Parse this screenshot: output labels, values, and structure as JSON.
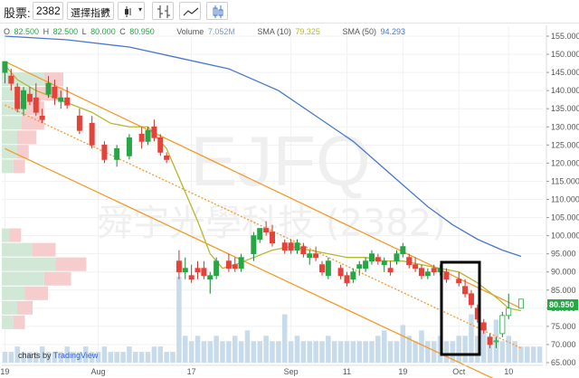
{
  "toolbar": {
    "symbol_label": "股票:",
    "symbol_value": "2382",
    "interval_select": "選擇指數",
    "buttons": [
      "chart-type-icon",
      "compare-icon",
      "line-style-icon",
      "candles-icon"
    ]
  },
  "legend": {
    "o_label": "O",
    "o_value": "82.500",
    "h_label": "H",
    "h_value": "82.500",
    "l_label": "L",
    "l_value": "80.000",
    "c_label": "C",
    "c_value": "80.950",
    "volume_label": "Volume",
    "volume_value": "7.052M",
    "sma10_label": "SMA (10)",
    "sma10_value": "79.325",
    "sma50_label": "SMA (50)",
    "sma50_value": "94.293"
  },
  "watermark": {
    "line1": "EJFQ",
    "line2": "舜宇光學科技 (2382)"
  },
  "attribution": {
    "prefix": "charts by",
    "brand": "TradingView"
  },
  "price_tag": "80.950",
  "colors": {
    "up": "#26a645",
    "down": "#e5433a",
    "sma10": "#b7b733",
    "sma50": "#4a78c8",
    "channel": "#f39a2b",
    "volume": "#c7dbea",
    "vprofile_up": "#cce6d3",
    "vprofile_down": "#f5c6c6",
    "price_tag_bg": "#26a645",
    "highlight_box": "#000000"
  },
  "chart_data": {
    "type": "candlestick",
    "ylim": [
      65,
      155
    ],
    "y_ticks": [
      "155.000",
      "150.000",
      "145.000",
      "140.000",
      "135.000",
      "130.000",
      "125.000",
      "120.000",
      "115.000",
      "110.000",
      "105.000",
      "100.000",
      "95.000",
      "90.000",
      "85.000",
      "80.000",
      "75.000",
      "70.000",
      "65.000"
    ],
    "x_ticks": [
      "19",
      "Aug",
      "17",
      "Sep",
      "11",
      "19",
      "Oct",
      "10"
    ],
    "x_tick_index": [
      0,
      15,
      30,
      46,
      55,
      64,
      73,
      81
    ],
    "n_bars": 87,
    "candles": [
      {
        "i": 0,
        "o": 145,
        "h": 147,
        "l": 142,
        "c": 148
      },
      {
        "i": 1,
        "o": 144,
        "h": 146,
        "l": 140,
        "c": 142
      },
      {
        "i": 2,
        "o": 141,
        "h": 142,
        "l": 134,
        "c": 135
      },
      {
        "i": 3,
        "o": 135,
        "h": 141,
        "l": 133,
        "c": 140
      },
      {
        "i": 4,
        "o": 139,
        "h": 141,
        "l": 136,
        "c": 137
      },
      {
        "i": 5,
        "o": 138,
        "h": 142,
        "l": 133,
        "c": 134
      },
      {
        "i": 6,
        "o": 133,
        "h": 135,
        "l": 131,
        "c": 132
      },
      {
        "i": 7,
        "o": 139,
        "h": 144,
        "l": 138,
        "c": 142
      },
      {
        "i": 8,
        "o": 141,
        "h": 143,
        "l": 136,
        "c": 138
      },
      {
        "i": 9,
        "o": 137,
        "h": 140,
        "l": 135,
        "c": 138
      },
      {
        "i": 10,
        "o": 138,
        "h": 141,
        "l": 135,
        "c": 136
      },
      {
        "i": 12,
        "o": 133,
        "h": 135,
        "l": 128,
        "c": 129
      },
      {
        "i": 14,
        "o": 131,
        "h": 133,
        "l": 124,
        "c": 125
      },
      {
        "i": 16,
        "o": 125,
        "h": 126,
        "l": 120,
        "c": 121
      },
      {
        "i": 18,
        "o": 121,
        "h": 125,
        "l": 119,
        "c": 124
      },
      {
        "i": 20,
        "o": 122,
        "h": 128,
        "l": 121,
        "c": 127
      },
      {
        "i": 22,
        "o": 128,
        "h": 130,
        "l": 124,
        "c": 126
      },
      {
        "i": 23,
        "o": 126,
        "h": 130,
        "l": 125,
        "c": 129
      },
      {
        "i": 24,
        "o": 130,
        "h": 132,
        "l": 126,
        "c": 127
      },
      {
        "i": 25,
        "o": 127,
        "h": 128,
        "l": 122,
        "c": 123
      },
      {
        "i": 26,
        "o": 122,
        "h": 123,
        "l": 120,
        "c": 121
      },
      {
        "i": 28,
        "o": 93,
        "h": 96,
        "l": 88,
        "c": 90
      },
      {
        "i": 29,
        "o": 90,
        "h": 94,
        "l": 88,
        "c": 91
      },
      {
        "i": 30,
        "o": 89,
        "h": 92,
        "l": 87,
        "c": 88
      },
      {
        "i": 31,
        "o": 91,
        "h": 93,
        "l": 88,
        "c": 90
      },
      {
        "i": 32,
        "o": 91,
        "h": 93,
        "l": 88,
        "c": 89
      },
      {
        "i": 33,
        "o": 88,
        "h": 90,
        "l": 84,
        "c": 89
      },
      {
        "i": 34,
        "o": 89,
        "h": 94,
        "l": 88,
        "c": 93
      },
      {
        "i": 36,
        "o": 93,
        "h": 95,
        "l": 90,
        "c": 91
      },
      {
        "i": 37,
        "o": 92,
        "h": 94,
        "l": 90,
        "c": 91
      },
      {
        "i": 38,
        "o": 91,
        "h": 95,
        "l": 90,
        "c": 94
      },
      {
        "i": 40,
        "o": 95,
        "h": 101,
        "l": 93,
        "c": 100
      },
      {
        "i": 41,
        "o": 99,
        "h": 102,
        "l": 98,
        "c": 102
      },
      {
        "i": 42,
        "o": 102,
        "h": 104,
        "l": 100,
        "c": 101
      },
      {
        "i": 43,
        "o": 101,
        "h": 103,
        "l": 97,
        "c": 98
      },
      {
        "i": 45,
        "o": 98,
        "h": 99,
        "l": 95,
        "c": 96
      },
      {
        "i": 46,
        "o": 98,
        "h": 99,
        "l": 95,
        "c": 96
      },
      {
        "i": 47,
        "o": 96,
        "h": 99,
        "l": 95,
        "c": 98
      },
      {
        "i": 48,
        "o": 97,
        "h": 98,
        "l": 94,
        "c": 95
      },
      {
        "i": 49,
        "o": 94,
        "h": 96,
        "l": 92,
        "c": 95
      },
      {
        "i": 50,
        "o": 95,
        "h": 97,
        "l": 93,
        "c": 94
      },
      {
        "i": 51,
        "o": 92,
        "h": 93,
        "l": 89,
        "c": 90
      },
      {
        "i": 52,
        "o": 89,
        "h": 94,
        "l": 88,
        "c": 93
      },
      {
        "i": 54,
        "o": 91,
        "h": 92,
        "l": 88,
        "c": 89
      },
      {
        "i": 55,
        "o": 89,
        "h": 90,
        "l": 86,
        "c": 87
      },
      {
        "i": 56,
        "o": 88,
        "h": 91,
        "l": 87,
        "c": 90
      },
      {
        "i": 57,
        "o": 91,
        "h": 93,
        "l": 89,
        "c": 92
      },
      {
        "i": 58,
        "o": 91,
        "h": 94,
        "l": 90,
        "c": 93
      },
      {
        "i": 59,
        "o": 93,
        "h": 96,
        "l": 92,
        "c": 95
      },
      {
        "i": 60,
        "o": 94,
        "h": 95,
        "l": 92,
        "c": 93
      },
      {
        "i": 61,
        "o": 92,
        "h": 94,
        "l": 90,
        "c": 93
      },
      {
        "i": 62,
        "o": 91,
        "h": 93,
        "l": 89,
        "c": 90
      },
      {
        "i": 63,
        "o": 93,
        "h": 96,
        "l": 92,
        "c": 95
      },
      {
        "i": 64,
        "o": 95,
        "h": 98,
        "l": 94,
        "c": 97
      },
      {
        "i": 65,
        "o": 94,
        "h": 95,
        "l": 91,
        "c": 92
      },
      {
        "i": 66,
        "o": 92,
        "h": 94,
        "l": 90,
        "c": 91
      },
      {
        "i": 67,
        "o": 91,
        "h": 92,
        "l": 88,
        "c": 89
      },
      {
        "i": 68,
        "o": 89,
        "h": 91,
        "l": 88,
        "c": 90
      },
      {
        "i": 69,
        "o": 91,
        "h": 92,
        "l": 89,
        "c": 90
      },
      {
        "i": 70,
        "o": 90,
        "h": 92,
        "l": 89,
        "c": 91
      },
      {
        "i": 71,
        "o": 90,
        "h": 91,
        "l": 87,
        "c": 88
      },
      {
        "i": 73,
        "o": 88,
        "h": 90,
        "l": 86,
        "c": 87
      },
      {
        "i": 74,
        "o": 86,
        "h": 88,
        "l": 83,
        "c": 84
      },
      {
        "i": 75,
        "o": 84,
        "h": 85,
        "l": 80,
        "c": 81
      },
      {
        "i": 76,
        "o": 80,
        "h": 81,
        "l": 76,
        "c": 77
      },
      {
        "i": 77,
        "o": 76,
        "h": 77,
        "l": 73,
        "c": 74
      },
      {
        "i": 78,
        "o": 72,
        "h": 73,
        "l": 69,
        "c": 70
      },
      {
        "i": 79,
        "o": 71,
        "h": 72,
        "l": 69,
        "c": 71
      },
      {
        "i": 80,
        "o": 73,
        "h": 79,
        "l": 72,
        "c": 78
      },
      {
        "i": 81,
        "o": 78,
        "h": 84,
        "l": 77,
        "c": 80
      },
      {
        "i": 83,
        "o": 80.0,
        "h": 82.5,
        "l": 80.0,
        "c": 82.5
      }
    ],
    "sma10": [
      [
        0,
        147
      ],
      [
        2,
        143
      ],
      [
        5,
        140
      ],
      [
        8,
        138
      ],
      [
        11,
        136
      ],
      [
        14,
        134
      ],
      [
        17,
        131
      ],
      [
        20,
        130
      ],
      [
        23,
        130
      ],
      [
        26,
        124
      ],
      [
        28,
        116
      ],
      [
        31,
        104
      ],
      [
        33,
        95
      ],
      [
        35,
        91
      ],
      [
        37,
        92
      ],
      [
        40,
        94
      ],
      [
        43,
        96
      ],
      [
        46,
        97
      ],
      [
        49,
        96
      ],
      [
        52,
        95
      ],
      [
        55,
        94
      ],
      [
        58,
        94
      ],
      [
        61,
        93
      ],
      [
        64,
        93
      ],
      [
        67,
        92
      ],
      [
        70,
        91
      ],
      [
        73,
        90
      ],
      [
        76,
        87
      ],
      [
        79,
        83
      ],
      [
        81,
        80
      ],
      [
        83,
        79.3
      ]
    ],
    "sma50": [
      [
        0,
        155
      ],
      [
        10,
        154
      ],
      [
        20,
        152
      ],
      [
        28,
        149
      ],
      [
        36,
        146
      ],
      [
        44,
        140
      ],
      [
        50,
        133
      ],
      [
        56,
        126
      ],
      [
        60,
        120
      ],
      [
        64,
        114
      ],
      [
        68,
        108
      ],
      [
        72,
        103
      ],
      [
        76,
        99
      ],
      [
        80,
        96
      ],
      [
        83,
        94.3
      ]
    ],
    "volume": [
      2,
      2,
      3,
      2,
      2,
      2,
      3,
      2,
      2,
      2,
      3,
      2,
      2,
      3,
      2,
      2,
      3,
      2,
      2,
      2,
      3,
      2,
      2,
      2,
      3,
      3,
      2,
      2,
      16,
      5,
      4,
      5,
      4,
      4,
      5,
      4,
      4,
      5,
      4,
      6,
      4,
      4,
      5,
      4,
      4,
      9,
      4,
      5,
      4,
      4,
      4,
      4,
      5,
      4,
      4,
      4,
      4,
      4,
      4,
      4,
      5,
      6,
      4,
      4,
      7,
      5,
      4,
      6,
      4,
      4,
      5,
      4,
      4,
      5,
      5,
      9,
      5,
      6,
      5,
      8,
      4,
      5,
      4,
      3,
      3,
      3,
      3
    ],
    "volume_max": 16,
    "volume_profile": [
      {
        "price": 143,
        "up": 0.55,
        "down": 0.25
      },
      {
        "price": 139,
        "up": 0.45,
        "down": 0.35
      },
      {
        "price": 135,
        "up": 0.3,
        "down": 0.25
      },
      {
        "price": 131,
        "up": 0.25,
        "down": 0.3
      },
      {
        "price": 127,
        "up": 0.2,
        "down": 0.25
      },
      {
        "price": 123,
        "up": 0.2,
        "down": 0.15
      },
      {
        "price": 119,
        "up": 0.15,
        "down": 0.15
      },
      {
        "price": 100,
        "up": 0.1,
        "down": 0.15
      },
      {
        "price": 96,
        "up": 0.4,
        "down": 0.3
      },
      {
        "price": 92,
        "up": 0.7,
        "down": 0.4
      },
      {
        "price": 88,
        "up": 0.55,
        "down": 0.35
      },
      {
        "price": 84,
        "up": 0.3,
        "down": 0.3
      },
      {
        "price": 80,
        "up": 0.2,
        "down": 0.2
      },
      {
        "price": 76,
        "up": 0.15,
        "down": 0.15
      }
    ],
    "channel_upper": [
      [
        0,
        148
      ],
      [
        83,
        80
      ]
    ],
    "channel_lower": [
      [
        0,
        124
      ],
      [
        83,
        57
      ]
    ],
    "channel_mid": [
      [
        0,
        136
      ],
      [
        83,
        69
      ]
    ]
  }
}
